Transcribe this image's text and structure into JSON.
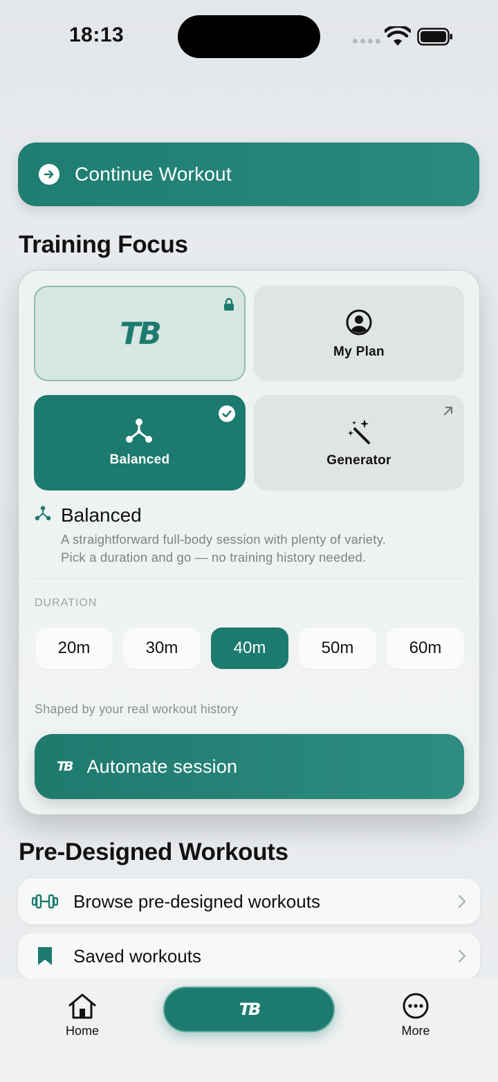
{
  "status_bar": {
    "time": "18:13"
  },
  "continue_workout": {
    "label": "Continue Workout"
  },
  "training_focus": {
    "title": "Training Focus",
    "tiles": {
      "tb": {
        "logo": "TB"
      },
      "my_plan": {
        "label": "My Plan"
      },
      "balanced": {
        "label": "Balanced"
      },
      "generator": {
        "label": "Generator"
      }
    },
    "selected_mode": {
      "title": "Balanced",
      "description_line1": "A straightforward full-body session with plenty of variety.",
      "description_line2": "Pick a duration and go — no training history needed."
    },
    "duration": {
      "label": "DURATION",
      "options": [
        "20m",
        "30m",
        "40m",
        "50m",
        "60m"
      ],
      "selected": "40m"
    },
    "note": "Shaped by your real workout history",
    "automate": {
      "icon_text": "TB",
      "label": "Automate session"
    }
  },
  "predesigned": {
    "title": "Pre-Designed Workouts",
    "items": [
      {
        "label": "Browse pre-designed workouts",
        "icon": "dumbbell-icon"
      },
      {
        "label": "Saved workouts",
        "icon": "bookmark-icon"
      }
    ]
  },
  "tab_bar": {
    "home": "Home",
    "center": "TB",
    "more": "More"
  },
  "colors": {
    "accent": "#1c7a6e",
    "accent_light": "#d6e6e2",
    "background": "#e9ecef"
  }
}
